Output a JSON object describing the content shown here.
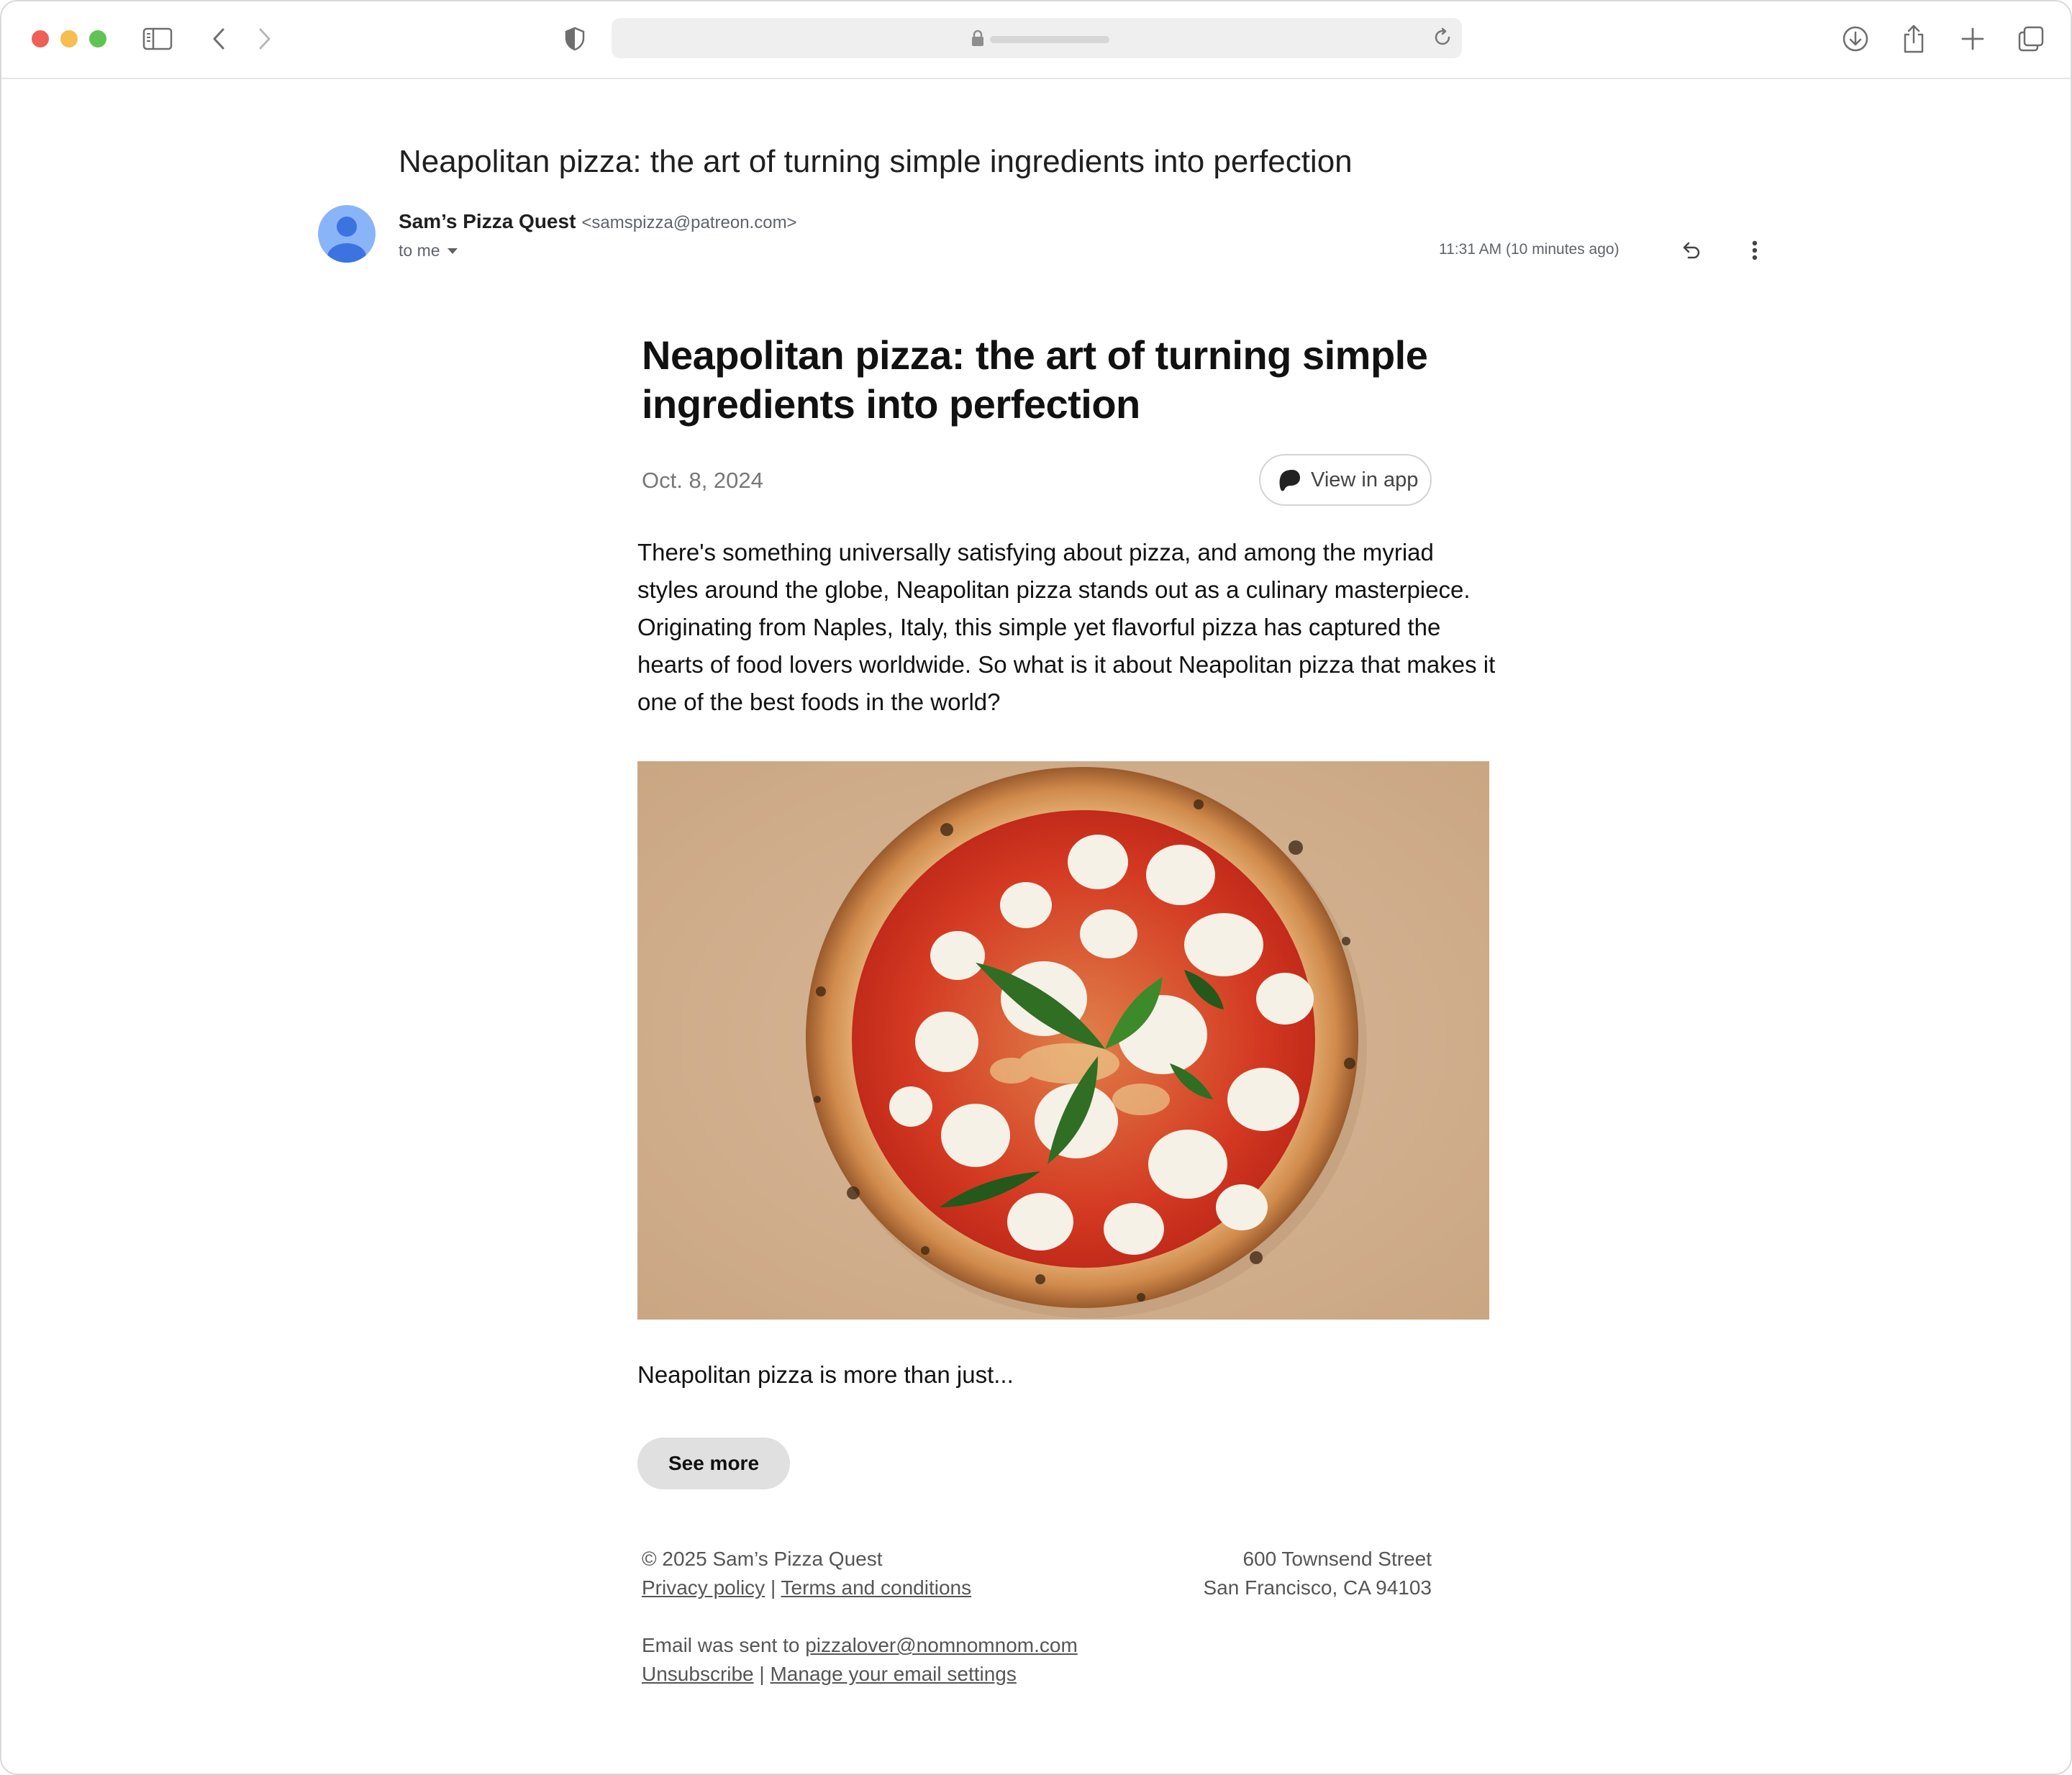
{
  "browser": {
    "controls": [
      "close",
      "minimize",
      "zoom"
    ],
    "icons": [
      "sidebar-icon",
      "back-icon",
      "forward-icon",
      "privacy-shield-icon",
      "lock-icon",
      "reload-icon",
      "download-icon",
      "share-icon",
      "new-tab-icon",
      "tab-overview-icon"
    ]
  },
  "email": {
    "subject": "Neapolitan pizza: the art of turning simple ingredients into perfection",
    "sender_name": "Sam’s Pizza Quest",
    "sender_email": "<samspizza@patreon.com>",
    "to": "to me",
    "time": "11:31 AM (10 minutes ago)"
  },
  "post": {
    "title": "Neapolitan pizza: the art of turning simple ingredients into perfection",
    "date": "Oct. 8, 2024",
    "view_in_app": "View in app",
    "body": "There's something universally satisfying about pizza, and among the myriad styles around the globe, Neapolitan pizza stands out as a culinary masterpiece. Originating from Naples, Italy, this simple yet flavorful pizza has captured the hearts of food lovers worldwide. So what is it about Neapolitan pizza that makes it one of the best foods in the world?",
    "teaser": "Neapolitan pizza is more than just...",
    "see_more": "See more"
  },
  "footer": {
    "copyright": "© 2025 Sam’s Pizza Quest",
    "privacy": "Privacy policy",
    "separator": "|",
    "terms": "Terms and conditions",
    "address_line1": "600 Townsend Street",
    "address_line2": "San Francisco, CA 94103",
    "sent_prefix": "Email was sent to",
    "sent_to": "pizzalover@nomnomnom.com",
    "unsubscribe": "Unsubscribe",
    "manage": "Manage your email settings"
  },
  "colors": {
    "close": "#ee5f57",
    "minimize": "#f5be4f",
    "zoom": "#5fc454",
    "avatar_bg": "#8ab4f8",
    "avatar_fg": "#3b73e0",
    "paper": "#d9b898"
  }
}
